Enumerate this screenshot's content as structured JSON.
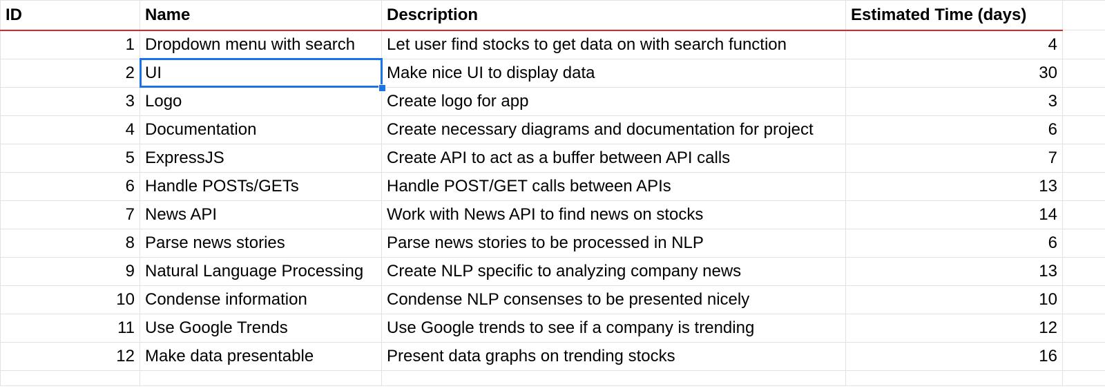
{
  "headers": {
    "id": "ID",
    "name": "Name",
    "description": "Description",
    "estimated_time": "Estimated Time (days)"
  },
  "selected_cell": "row 2, Name column",
  "colors": {
    "header_underline": "#d8262b",
    "selection": "#1a73e8",
    "gridline": "#e2e2e2"
  },
  "rows": [
    {
      "id": "1",
      "name": "Dropdown menu with search",
      "description": "Let user find stocks to get data on with search function",
      "time": "4"
    },
    {
      "id": "2",
      "name": "UI",
      "description": "Make nice UI to display data",
      "time": "30"
    },
    {
      "id": "3",
      "name": "Logo",
      "description": "Create logo for app",
      "time": "3"
    },
    {
      "id": "4",
      "name": "Documentation",
      "description": "Create necessary diagrams and documentation for project",
      "time": "6"
    },
    {
      "id": "5",
      "name": "ExpressJS",
      "description": "Create API to act as a buffer between API calls",
      "time": "7"
    },
    {
      "id": "6",
      "name": "Handle POSTs/GETs",
      "description": "Handle POST/GET calls between APIs",
      "time": "13"
    },
    {
      "id": "7",
      "name": "News API",
      "description": "Work with News API to find news on stocks",
      "time": "14"
    },
    {
      "id": "8",
      "name": "Parse news stories",
      "description": "Parse news stories to be processed in NLP",
      "time": "6"
    },
    {
      "id": "9",
      "name": "Natural Language Processing",
      "description": "Create NLP specific to analyzing company news",
      "time": "13"
    },
    {
      "id": "10",
      "name": "Condense information",
      "description": "Condense NLP consenses to be presented nicely",
      "time": "10"
    },
    {
      "id": "11",
      "name": "Use Google Trends",
      "description": "Use Google trends to see if a company is trending",
      "time": "12"
    },
    {
      "id": "12",
      "name": "Make data presentable",
      "description": "Present data graphs on trending stocks",
      "time": "16"
    }
  ]
}
